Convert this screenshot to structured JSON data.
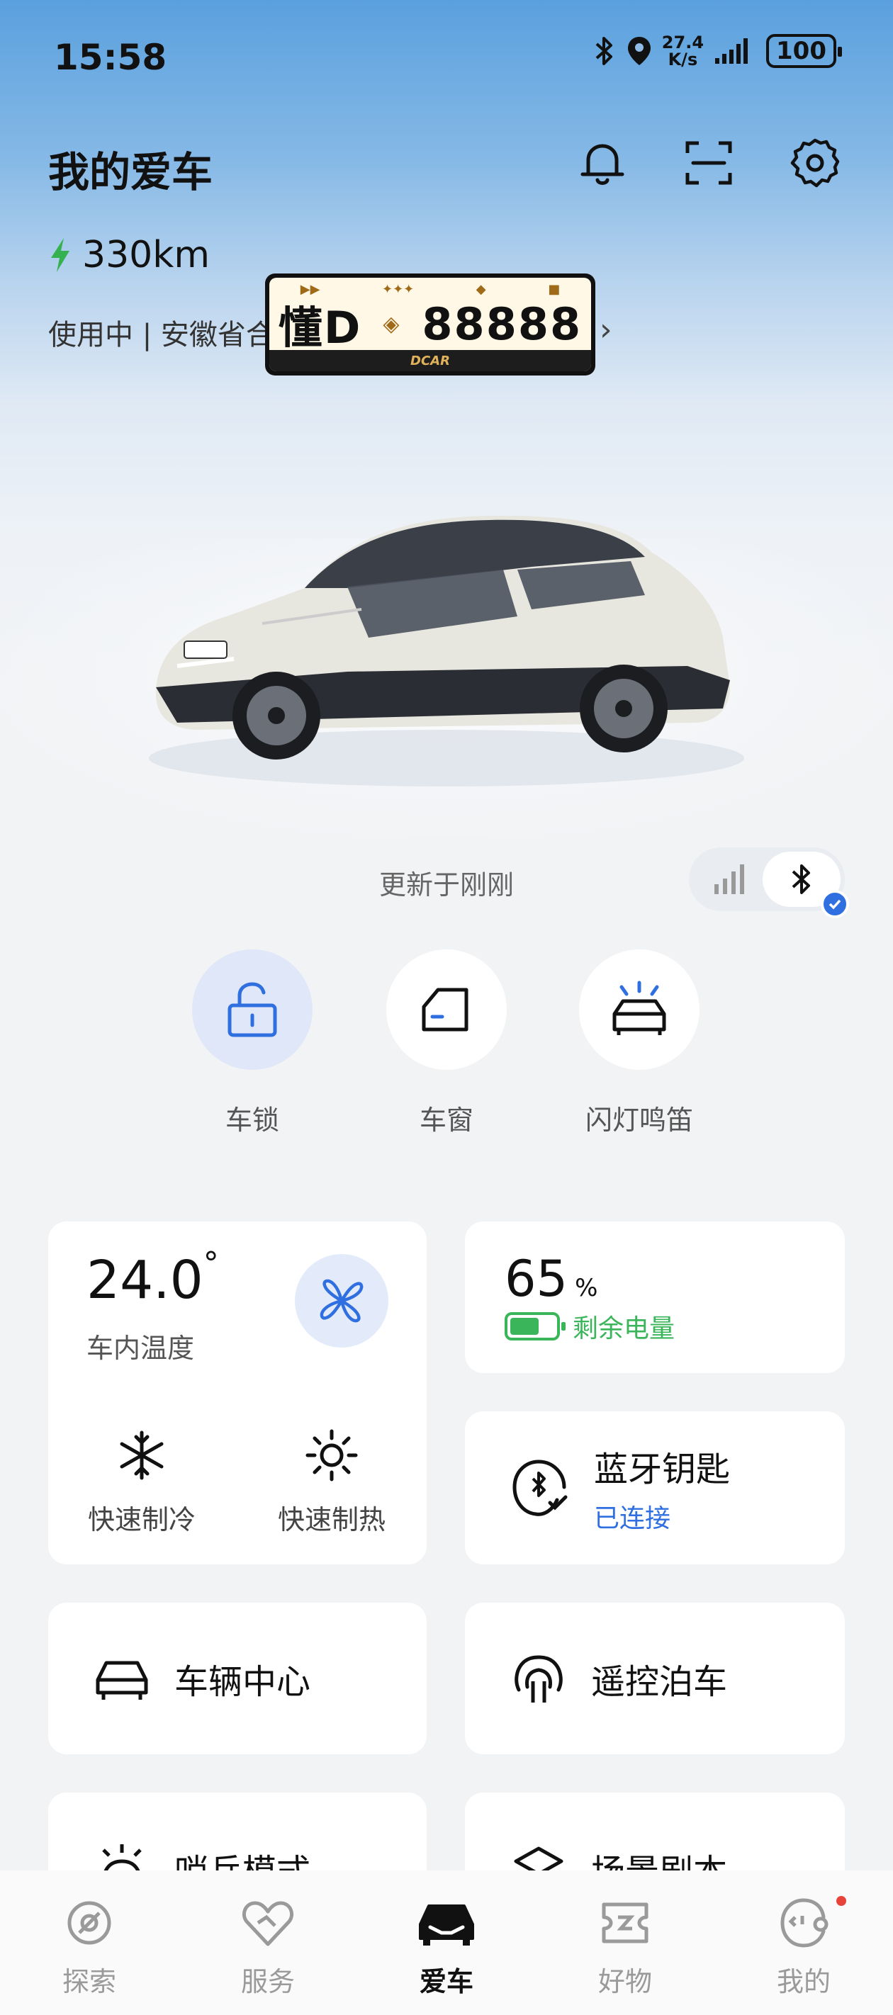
{
  "status_bar": {
    "time": "15:58",
    "net_speed_value": "27.4",
    "net_speed_unit": "K/s",
    "battery": "100"
  },
  "header": {
    "title": "我的爱车"
  },
  "vehicle": {
    "range": "330km",
    "status_line": "使用中 | 安徽省合",
    "plate_prefix": "懂D",
    "plate_number": "88888",
    "plate_footer": "DCAR",
    "update_text": "更新于刚刚"
  },
  "quick_actions": [
    {
      "label": "车锁",
      "icon": "unlock-icon"
    },
    {
      "label": "车窗",
      "icon": "car-window-icon"
    },
    {
      "label": "闪灯鸣笛",
      "icon": "flash-horn-icon"
    }
  ],
  "climate": {
    "temperature": "24.0",
    "degree_symbol": "°",
    "label": "车内温度",
    "cool_label": "快速制冷",
    "heat_label": "快速制热"
  },
  "battery_card": {
    "value": "65",
    "unit": "%",
    "label": "剩余电量",
    "level": 0.65,
    "color": "#3ab55a"
  },
  "bt_key": {
    "title": "蓝牙钥匙",
    "status": "已连接"
  },
  "cards": {
    "vehicle_center": "车辆中心",
    "remote_parking": "遥控泊车",
    "sentry_mode": "哨兵模式",
    "scene": "场景剧本"
  },
  "tabs": [
    {
      "label": "探索",
      "icon": "explore-icon"
    },
    {
      "label": "服务",
      "icon": "service-icon"
    },
    {
      "label": "爱车",
      "icon": "car-icon"
    },
    {
      "label": "好物",
      "icon": "goods-icon"
    },
    {
      "label": "我的",
      "icon": "profile-icon"
    }
  ],
  "colors": {
    "accent": "#2f6fe0",
    "battery_green": "#3ab55a",
    "active_lock_bg": "#dfe7f8"
  }
}
